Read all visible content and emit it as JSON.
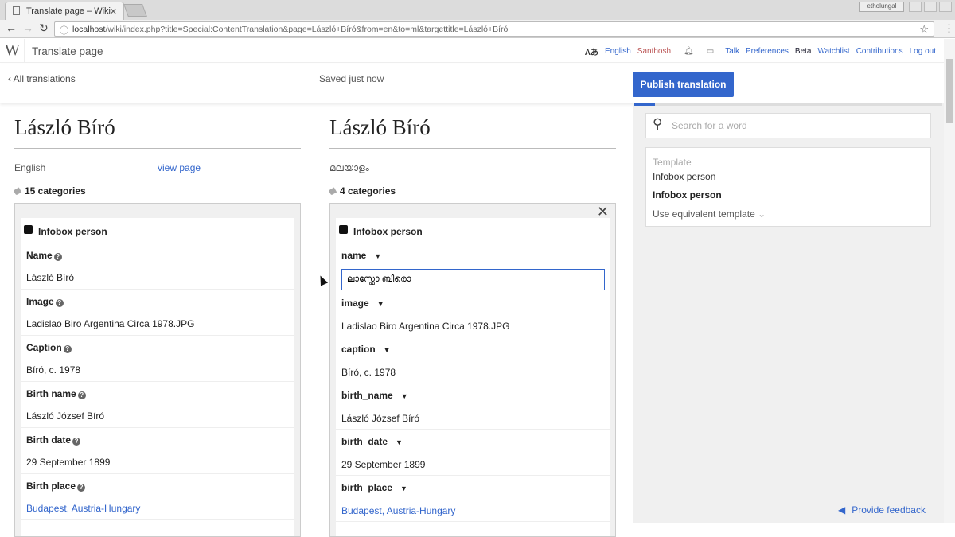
{
  "browser": {
    "tab_title": "Translate page – Wiki",
    "url_host": "localhost",
    "url_path": "/wiki/index.php?title=Special:ContentTranslation&page=László+Bíró&from=en&to=ml&targettitle=László+Bíró",
    "window_user": "etholungal"
  },
  "header": {
    "title": "Translate page",
    "logo": "W",
    "language": "English",
    "user": "Santhosh",
    "links": [
      "Talk",
      "Preferences",
      "Beta",
      "Watchlist",
      "Contributions",
      "Log out"
    ]
  },
  "toolbar": {
    "back": "All translations",
    "status": "Saved just now",
    "publish": "Publish translation"
  },
  "source": {
    "title": "László Bíró",
    "language": "English",
    "view_page": "view page",
    "categories": "15 categories",
    "infobox": "Infobox person",
    "fields": [
      {
        "label": "Name",
        "value": "László Bíró"
      },
      {
        "label": "Image",
        "value": "Ladislao Biro Argentina Circa 1978.JPG"
      },
      {
        "label": "Caption",
        "value": "Bíró, c. 1978"
      },
      {
        "label": "Birth name",
        "value": "László József Bíró"
      },
      {
        "label": "Birth date",
        "value": "29 September 1899"
      },
      {
        "label": "Birth place",
        "value": "Budapest, Austria-Hungary",
        "link": true
      }
    ]
  },
  "target": {
    "title": "László Bíró",
    "language": "മലയാളം",
    "categories": "4 categories",
    "infobox": "Infobox person",
    "name_label": "name",
    "name_value": "ലാസ്ലോ ബിരൊ",
    "fields": [
      {
        "label": "image",
        "value": "Ladislao Biro Argentina Circa 1978.JPG"
      },
      {
        "label": "caption",
        "value": "Bíró, c. 1978"
      },
      {
        "label": "birth_name",
        "value": "László József Bíró"
      },
      {
        "label": "birth_date",
        "value": "29 September 1899"
      },
      {
        "label": "birth_place",
        "value": "Budapest, Austria-Hungary",
        "link": true
      }
    ]
  },
  "tools": {
    "search_placeholder": "Search for a word",
    "template_heading": "Template",
    "source_template": "Infobox person",
    "target_template": "Infobox person",
    "equivalent": "Use equivalent template",
    "feedback": "Provide feedback"
  },
  "colors": {
    "accent": "#3366cc",
    "panel": "#f0f0f0"
  }
}
